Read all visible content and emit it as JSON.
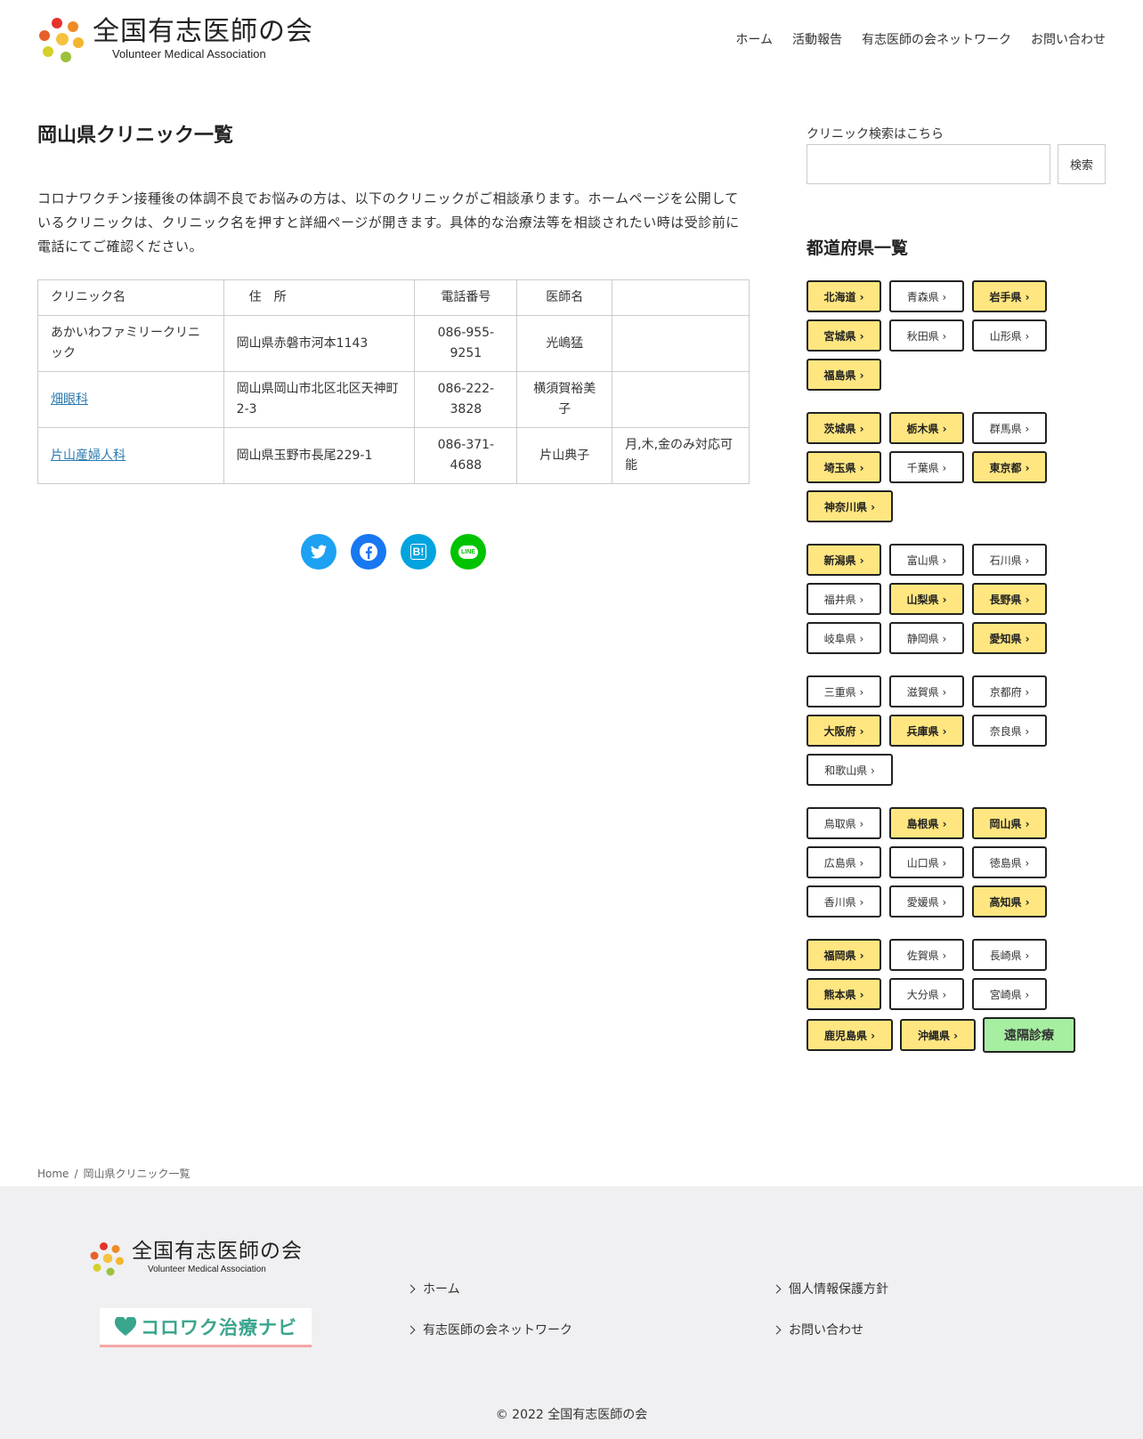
{
  "header": {
    "site_title": "全国有志医師の会",
    "site_subtitle": "Volunteer Medical Association",
    "nav": [
      "ホーム",
      "活動報告",
      "有志医師の会ネットワーク",
      "お問い合わせ"
    ]
  },
  "main": {
    "title": "岡山県クリニック一覧",
    "intro": "コロナワクチン接種後の体調不良でお悩みの方は、以下のクリニックがご相談承ります。ホームページを公開しているクリニックは、クリニック名を押すと詳細ページが開きます。具体的な治療法等を相談されたい時は受診前に電話にてご確認ください。",
    "table": {
      "headers": [
        "クリニック名",
        "住　所",
        "電話番号",
        "医師名",
        ""
      ],
      "rows": [
        {
          "name": "あかいわファミリークリニック",
          "address": "岡山県赤磐市河本1143",
          "phone": "086-955-9251",
          "doctor": "光嶋猛",
          "note": ""
        },
        {
          "name": "畑眼科",
          "address": "岡山県岡山市北区北区天神町2-3",
          "phone": "086-222-3828",
          "doctor": "横須賀裕美子",
          "note": ""
        },
        {
          "name": "片山産婦人科",
          "address": "岡山県玉野市長尾229-1",
          "phone": "086-371-4688",
          "doctor": "片山典子",
          "note": "月,木,金のみ対応可能"
        }
      ]
    },
    "share": {
      "twitter_icon": "twitter-icon",
      "facebook_icon": "facebook-icon",
      "hatena_label": "B!",
      "line_label": "LINE"
    }
  },
  "sidebar": {
    "search_label": "クリニック検索はこちら",
    "search_value": "",
    "search_button": "検索",
    "pref_title": "都道府県一覧",
    "prefectures": [
      {
        "label": "北海道 ›",
        "hl": true
      },
      {
        "label": "青森県 ›",
        "hl": false
      },
      {
        "label": "岩手県 ›",
        "hl": true
      },
      {
        "label": "宮城県 ›",
        "hl": true
      },
      {
        "label": "秋田県 ›",
        "hl": false
      },
      {
        "label": "山形県 ›",
        "hl": false
      },
      {
        "label": "福島県 ›",
        "hl": true
      },
      {
        "label": "茨城県 ›",
        "hl": true
      },
      {
        "label": "栃木県 ›",
        "hl": true
      },
      {
        "label": "群馬県 ›",
        "hl": false
      },
      {
        "label": "埼玉県 ›",
        "hl": true
      },
      {
        "label": "千葉県 ›",
        "hl": false
      },
      {
        "label": "東京都 ›",
        "hl": true
      },
      {
        "label": "神奈川県 ›",
        "hl": true
      },
      {
        "label": "新潟県 ›",
        "hl": true
      },
      {
        "label": "富山県 ›",
        "hl": false
      },
      {
        "label": "石川県 ›",
        "hl": false
      },
      {
        "label": "福井県 ›",
        "hl": false
      },
      {
        "label": "山梨県 ›",
        "hl": true
      },
      {
        "label": "長野県 ›",
        "hl": true
      },
      {
        "label": "岐阜県 ›",
        "hl": false
      },
      {
        "label": "静岡県 ›",
        "hl": false
      },
      {
        "label": "愛知県 ›",
        "hl": true
      },
      {
        "label": "三重県 ›",
        "hl": false
      },
      {
        "label": "滋賀県 ›",
        "hl": false
      },
      {
        "label": "京都府 ›",
        "hl": false
      },
      {
        "label": "大阪府 ›",
        "hl": true
      },
      {
        "label": "兵庫県 ›",
        "hl": true
      },
      {
        "label": "奈良県 ›",
        "hl": false
      },
      {
        "label": "和歌山県 ›",
        "hl": false
      },
      {
        "label": "鳥取県 ›",
        "hl": false
      },
      {
        "label": "島根県 ›",
        "hl": true
      },
      {
        "label": "岡山県 ›",
        "hl": true
      },
      {
        "label": "広島県 ›",
        "hl": false
      },
      {
        "label": "山口県 ›",
        "hl": false
      },
      {
        "label": "徳島県 ›",
        "hl": false
      },
      {
        "label": "香川県 ›",
        "hl": false
      },
      {
        "label": "愛媛県 ›",
        "hl": false
      },
      {
        "label": "高知県 ›",
        "hl": true
      },
      {
        "label": "福岡県 ›",
        "hl": true
      },
      {
        "label": "佐賀県 ›",
        "hl": false
      },
      {
        "label": "長崎県 ›",
        "hl": false
      },
      {
        "label": "熊本県 ›",
        "hl": true
      },
      {
        "label": "大分県 ›",
        "hl": false
      },
      {
        "label": "宮崎県 ›",
        "hl": false
      },
      {
        "label": "鹿児島県 ›",
        "hl": true
      },
      {
        "label": "沖縄県 ›",
        "hl": true
      },
      {
        "label": "遠隔診療",
        "hl": true,
        "remote": true
      }
    ],
    "colors": {
      "highlight": "#ffe680",
      "remote": "#a6eea0"
    }
  },
  "breadcrumb": {
    "home": "Home",
    "sep": "/",
    "current": "岡山県クリニック一覧"
  },
  "footer": {
    "site_title": "全国有志医師の会",
    "site_subtitle": "Volunteer Medical Association",
    "banner": "コロワク治療ナビ",
    "links_col1": [
      "ホーム",
      "有志医師の会ネットワーク"
    ],
    "links_col2": [
      "個人情報保護方針",
      "お問い合わせ"
    ],
    "copyright": "© 2022 全国有志医師の会"
  }
}
